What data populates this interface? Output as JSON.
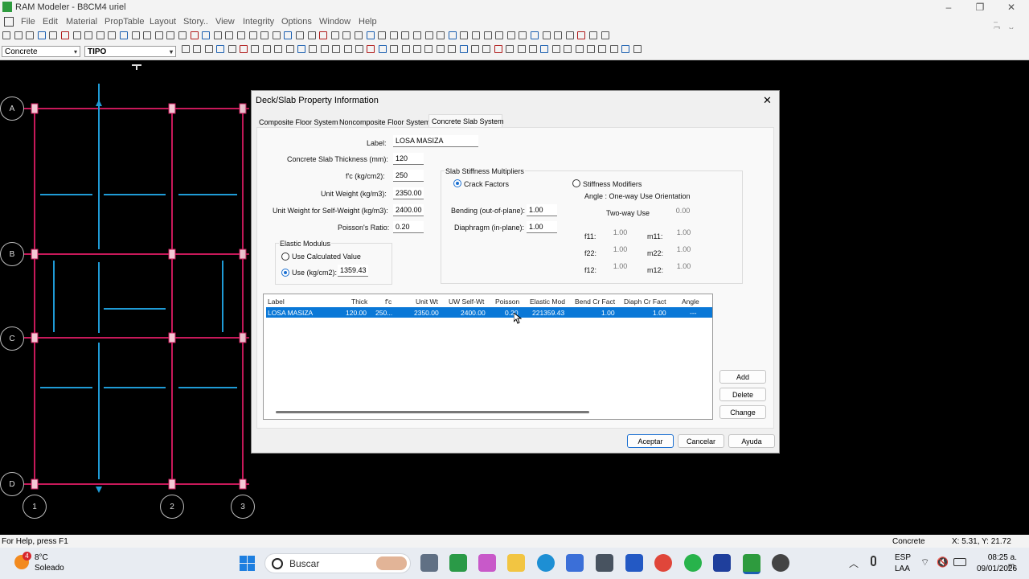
{
  "app": {
    "title": "RAM Modeler - B8CM4 uriel",
    "window_controls": [
      "–",
      "❐",
      "✕"
    ]
  },
  "menu": [
    "File",
    "Edit",
    "Material",
    "PropTable",
    "Layout",
    "Story..",
    "View",
    "Integrity",
    "Options",
    "Window",
    "Help"
  ],
  "toolbar": {
    "material_combo": "Concrete",
    "story_combo": "TIPO"
  },
  "grid": {
    "rows": [
      "A",
      "B",
      "C",
      "D"
    ],
    "cols": [
      "1",
      "2",
      "3"
    ]
  },
  "dialog": {
    "title": "Deck/Slab Property Information",
    "close": "✕",
    "tabs": [
      "Composite Floor System",
      "Noncomposite Floor System",
      "Concrete Slab System"
    ],
    "fields": {
      "label_lbl": "Label:",
      "label_val": "LOSA MASIZA",
      "thick_lbl": "Concrete Slab Thickness  (mm):",
      "thick_val": "120",
      "fc_lbl": "f'c (kg/cm2):",
      "fc_val": "250",
      "uw_lbl": "Unit Weight (kg/m3):",
      "uw_val": "2350.00",
      "uwsw_lbl": "Unit Weight for Self-Weight (kg/m3):",
      "uwsw_val": "2400.00",
      "poisson_lbl": "Poisson's Ratio:",
      "poisson_val": "0.20"
    },
    "elastic": {
      "title": "Elastic Modulus",
      "calc": "Use Calculated Value",
      "use": "Use (kg/cm2):",
      "use_val": "1359.43"
    },
    "stiffness": {
      "title": "Slab Stiffness Multipliers",
      "crack": "Crack Factors",
      "modifiers": "Stiffness Modifiers",
      "angle": "Angle : One-way Use Orientation",
      "twoway": "Two-way Use",
      "twoway_val": "0.00",
      "bending_lbl": "Bending (out-of-plane):",
      "bending_val": "1.00",
      "diaph_lbl": "Diaphragm (in-plane):",
      "diaph_val": "1.00",
      "f11": "f11:",
      "f11_val": "1.00",
      "m11": "m11:",
      "m11_val": "1.00",
      "f22": "f22:",
      "f22_val": "1.00",
      "m22": "m22:",
      "m22_val": "1.00",
      "f12": "f12:",
      "f12_val": "1.00",
      "m12": "m12:",
      "m12_val": "1.00"
    },
    "table": {
      "headers": [
        "Label",
        "Thick",
        "f'c",
        "Unit Wt",
        "UW Self-Wt",
        "Poisson",
        "Elastic Mod",
        "Bend Cr Fact",
        "Diaph Cr Fact",
        "Angle"
      ],
      "rows": [
        [
          "LOSA MASIZA",
          "120.00",
          "250...",
          "2350.00",
          "2400.00",
          "0.20",
          "221359.43",
          "1.00",
          "1.00",
          "---"
        ]
      ]
    },
    "buttons": {
      "add": "Add",
      "delete": "Delete",
      "change": "Change",
      "ok": "Aceptar",
      "cancel": "Cancelar",
      "help": "Ayuda"
    }
  },
  "status": {
    "help": "For Help, press F1",
    "material": "Concrete",
    "coords": "X:  5.31, Y:  21.72"
  },
  "taskbar": {
    "weather_temp": "8°C",
    "weather_desc": "Soleado",
    "weather_badge": "4",
    "search": "Buscar",
    "lang1": "ESP",
    "lang2": "LAA",
    "time": "08:25 a. m.",
    "date": "09/01/2026"
  },
  "colors": {
    "beam": "#c8195a",
    "wall": "#1f9bd6",
    "selection": "#0a78d7"
  }
}
